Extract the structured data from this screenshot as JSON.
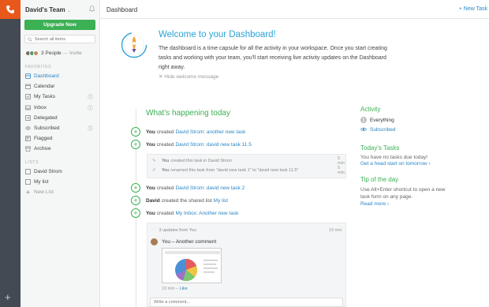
{
  "rail": {
    "logo_icon": "phone-icon",
    "add_icon": "plus-icon",
    "add_label": "+"
  },
  "sidebar": {
    "team_name": "David's Team",
    "team_chevron": "⌄",
    "upgrade_label": "Upgrade Now",
    "search_placeholder": "Search all items",
    "people": {
      "count": "3 People",
      "separator": "—",
      "invite": "Invite"
    },
    "favorites_label": "FAVORITES",
    "favorites": [
      {
        "label": "Dashboard",
        "icon": "dashboard-icon",
        "active": true
      },
      {
        "label": "Calendar",
        "icon": "calendar-icon"
      },
      {
        "label": "My Tasks",
        "icon": "tasks-icon",
        "badge": "6"
      },
      {
        "label": "Inbox",
        "icon": "inbox-icon",
        "badge": "1"
      },
      {
        "label": "Delegated",
        "icon": "delegated-icon"
      },
      {
        "label": "Subscribed",
        "icon": "subscribed-icon",
        "badge": "5"
      },
      {
        "label": "Flagged",
        "icon": "flag-icon"
      },
      {
        "label": "Archive",
        "icon": "archive-icon"
      }
    ],
    "lists_label": "LISTS",
    "lists": [
      {
        "label": "David Strom",
        "icon": "list-icon"
      },
      {
        "label": "My list",
        "icon": "list-icon"
      },
      {
        "label": "New List",
        "icon": "plus-icon"
      }
    ]
  },
  "topbar": {
    "title": "Dashboard",
    "new_task": "+ New Task"
  },
  "welcome": {
    "title": "Welcome to your Dashboard!",
    "body": "The dashboard is a time capsule for all the activity in your workspace. Once you start creating tasks and working with your team, you'll start receiving live activity updates on the Dashboard right away.",
    "hide": "✕ Hide welcome message"
  },
  "feed": {
    "title": "What's happening today",
    "items": [
      {
        "actor": "You",
        "verb": "created",
        "target": "David Strom: another new task"
      },
      {
        "actor": "You",
        "verb": "created",
        "target": "David Strom: david new task 11.5"
      },
      {
        "actor": "You",
        "verb": "created",
        "target": "David Strom: david new task 2"
      },
      {
        "actor": "David",
        "verb": "created the shared list",
        "target": "My list"
      },
      {
        "actor": "You",
        "verb": "created",
        "target": "My Inbox: Another new task"
      }
    ],
    "sub_events": [
      {
        "icon": "pencil-icon",
        "actor": "You",
        "text": "created this task in David Strom",
        "time": "5 min"
      },
      {
        "icon": "edit-icon",
        "actor": "You",
        "text": "renamed this task from \"david new task 1\" to \"david new task 11.5\"",
        "time": "5 min"
      }
    ],
    "comment": {
      "updates": "3 updates from You",
      "time": "19 min",
      "author": "You – Another comment",
      "meta_time": "19 min",
      "meta_sep": "–",
      "like": "Like",
      "input_placeholder": "Write a comment..."
    }
  },
  "right": {
    "activity_title": "Activity",
    "everything": "Everything",
    "subscribed": "Subscribed",
    "tasks_title": "Today's Tasks",
    "tasks_text": "You have no tasks due today!",
    "tasks_link": "Get a head start on tomorrow ›",
    "tip_title": "Tip of the day",
    "tip_text": "Use Alt+Enter shortcut to open a new task form on any page.",
    "read_more": "Read more ›"
  },
  "colors": {
    "accent_green": "#3cb054",
    "link_blue": "#2b86c3",
    "brand_orange": "#e8581b",
    "rail": "#434a54"
  }
}
